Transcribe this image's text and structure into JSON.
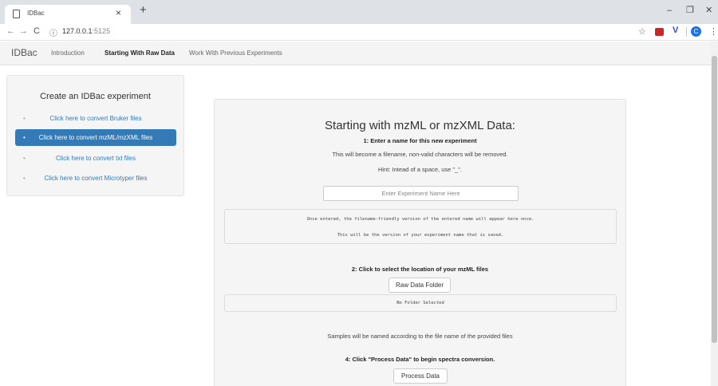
{
  "browser": {
    "tab_title": "IDBac",
    "tab_close": "×",
    "new_tab": "+",
    "url_host": "127.0.0.1",
    "url_port": ":5125",
    "icons": [
      "page-icon",
      "close-icon",
      "plus-icon",
      "back-icon",
      "forward-icon",
      "reload-icon",
      "info-icon",
      "star-icon",
      "extension-icon",
      "profile-avatar",
      "menu-icon"
    ],
    "avatar_letter": "C"
  },
  "navbar": {
    "brand": "IDBac",
    "links": [
      "Introduction",
      "Starting With Raw Data",
      "Work With Previous Experiments"
    ],
    "active_index": 1
  },
  "sidebar": {
    "title": "Create an IDBac experiment",
    "items": [
      {
        "label": "Click here to convert Bruker files",
        "active": false
      },
      {
        "label": "Click here to convert mzML/mzXML files",
        "active": true
      },
      {
        "label": "Click here to convert txt files",
        "active": false
      },
      {
        "label": "Click here to convert Microtyper files",
        "active": false
      }
    ]
  },
  "main": {
    "heading": "Starting with mzML or mzXML Data:",
    "step1_label": "1: Enter a name for this new experiment",
    "step1_note": "This will become a filename, non-valid characters will be removed.",
    "step1_hint": "Hint: Intead of a space, use \"_\".",
    "name_placeholder": "Enter Experiment Name Here",
    "preview_line1": "Once entered, the filename-friendly version of the entered name will appear here once.",
    "preview_line2": "This will be the version of your experiment name that is saved.",
    "step2_label": "2: Click to select the location of your mzML files",
    "raw_folder_button": "Raw Data Folder",
    "folder_status": "No Folder Selected",
    "samples_note": "Samples will be named according to the file name of the provided files",
    "step4_label": "4: Click \"Process Data\" to begin spectra conversion.",
    "process_button": "Process Data"
  },
  "colors": {
    "accent": "#337ab7",
    "panel_bg": "#f5f5f5",
    "navbar_bg": "#f4f4f4",
    "tabstrip_bg": "#dee1e6"
  }
}
